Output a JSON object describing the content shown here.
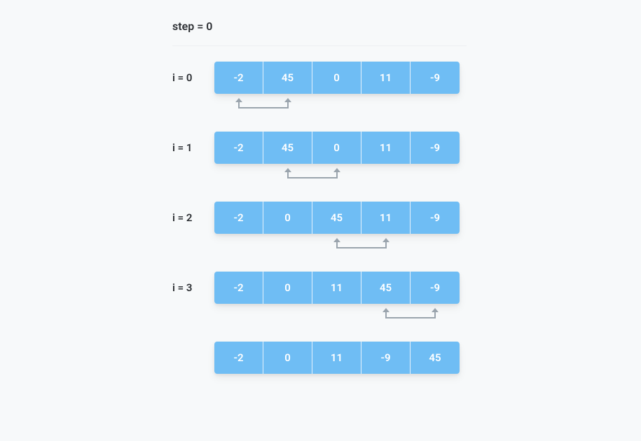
{
  "step": {
    "label": "step = 0"
  },
  "rows": [
    {
      "label": "i = 0",
      "values": [
        "-2",
        "45",
        "0",
        "11",
        "-9"
      ],
      "compare": [
        0,
        1
      ]
    },
    {
      "label": "i = 1",
      "values": [
        "-2",
        "45",
        "0",
        "11",
        "-9"
      ],
      "compare": [
        1,
        2
      ]
    },
    {
      "label": "i = 2",
      "values": [
        "-2",
        "0",
        "45",
        "11",
        "-9"
      ],
      "compare": [
        2,
        3
      ]
    },
    {
      "label": "i = 3",
      "values": [
        "-2",
        "0",
        "11",
        "45",
        "-9"
      ],
      "compare": [
        3,
        4
      ]
    },
    {
      "label": "",
      "values": [
        "-2",
        "0",
        "11",
        "-9",
        "45"
      ],
      "compare": null
    }
  ],
  "colors": {
    "cell_bg": "#6fbdf4",
    "arrow": "#9aa4ad",
    "bg": "#f7f9fa"
  }
}
